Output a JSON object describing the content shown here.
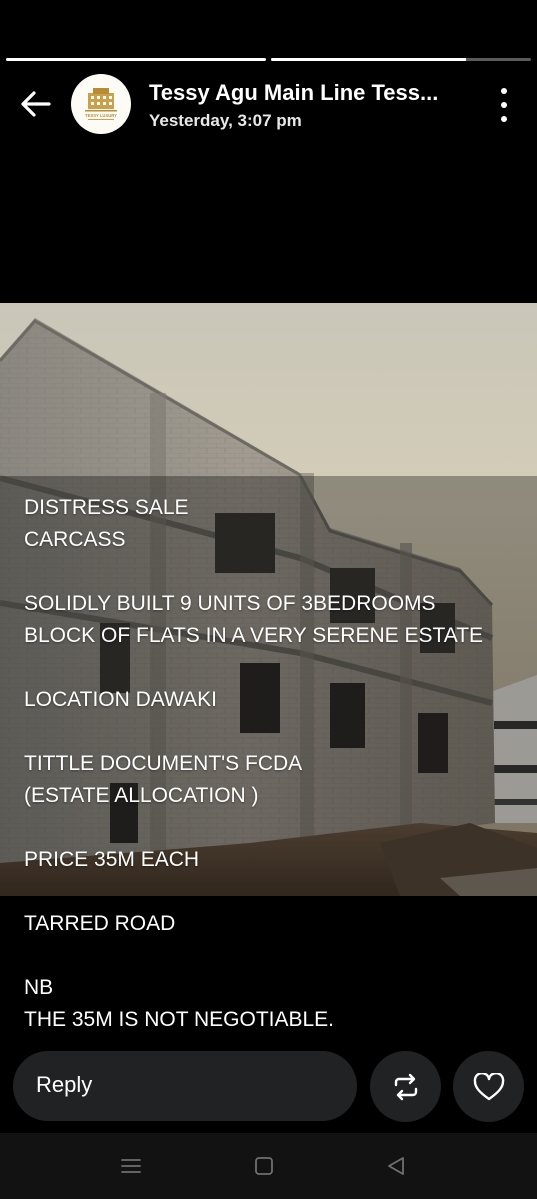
{
  "status": {
    "progress": [
      {
        "segment": 1,
        "fill_percent": 100
      },
      {
        "segment": 2,
        "fill_percent": 75
      }
    ]
  },
  "header": {
    "title": "Tessy Agu Main Line Tess...",
    "timestamp": "Yesterday, 3:07 pm",
    "avatar_logo_text": "TESSY LUXURY"
  },
  "caption": {
    "lines": [
      "DISTRESS SALE",
      "CARCASS",
      "",
      "SOLIDLY BUILT 9 UNITS OF 3BEDROOMS",
      "BLOCK OF FLATS IN A VERY SERENE ESTATE",
      "",
      "LOCATION DAWAKI",
      "",
      "TITTLE DOCUMENT'S FCDA",
      "(ESTATE ALLOCATION )",
      "",
      "PRICE 35M EACH",
      "",
      "TARRED ROAD",
      "",
      "NB",
      "THE 35M IS NOT NEGOTIABLE."
    ]
  },
  "footer": {
    "reply_label": "Reply"
  },
  "icons": {
    "back": "arrow-left-icon",
    "menu": "more-vertical-icon",
    "repost": "repost-icon",
    "like": "heart-icon",
    "nav_menu": "recent-apps-icon",
    "nav_home": "home-square-icon",
    "nav_back": "triangle-back-icon"
  },
  "colors": {
    "background": "#000000",
    "button_bg": "#202224",
    "navbar_bg": "#121212",
    "progress_track": "#5a5a5a",
    "progress_fill": "#ffffff",
    "logo_gold": "#c9a14a"
  }
}
